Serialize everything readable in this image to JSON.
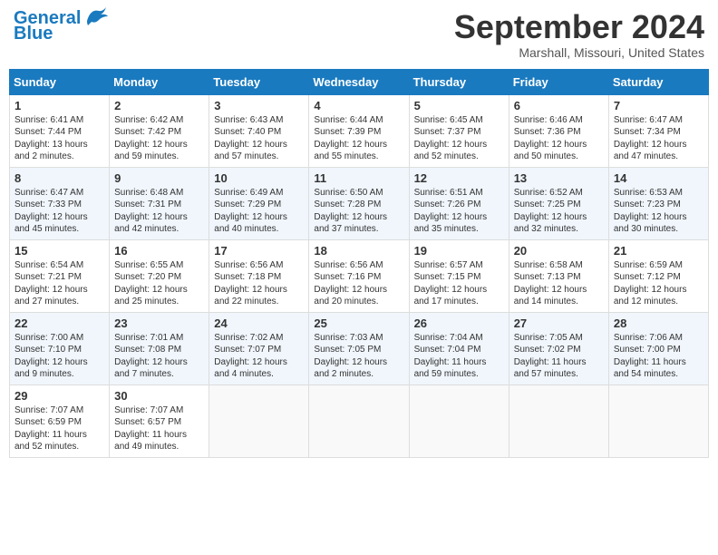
{
  "header": {
    "logo_line1": "General",
    "logo_line2": "Blue",
    "month_year": "September 2024",
    "location": "Marshall, Missouri, United States"
  },
  "days_of_week": [
    "Sunday",
    "Monday",
    "Tuesday",
    "Wednesday",
    "Thursday",
    "Friday",
    "Saturday"
  ],
  "weeks": [
    [
      {
        "day": "1",
        "info": "Sunrise: 6:41 AM\nSunset: 7:44 PM\nDaylight: 13 hours\nand 2 minutes."
      },
      {
        "day": "2",
        "info": "Sunrise: 6:42 AM\nSunset: 7:42 PM\nDaylight: 12 hours\nand 59 minutes."
      },
      {
        "day": "3",
        "info": "Sunrise: 6:43 AM\nSunset: 7:40 PM\nDaylight: 12 hours\nand 57 minutes."
      },
      {
        "day": "4",
        "info": "Sunrise: 6:44 AM\nSunset: 7:39 PM\nDaylight: 12 hours\nand 55 minutes."
      },
      {
        "day": "5",
        "info": "Sunrise: 6:45 AM\nSunset: 7:37 PM\nDaylight: 12 hours\nand 52 minutes."
      },
      {
        "day": "6",
        "info": "Sunrise: 6:46 AM\nSunset: 7:36 PM\nDaylight: 12 hours\nand 50 minutes."
      },
      {
        "day": "7",
        "info": "Sunrise: 6:47 AM\nSunset: 7:34 PM\nDaylight: 12 hours\nand 47 minutes."
      }
    ],
    [
      {
        "day": "8",
        "info": "Sunrise: 6:47 AM\nSunset: 7:33 PM\nDaylight: 12 hours\nand 45 minutes."
      },
      {
        "day": "9",
        "info": "Sunrise: 6:48 AM\nSunset: 7:31 PM\nDaylight: 12 hours\nand 42 minutes."
      },
      {
        "day": "10",
        "info": "Sunrise: 6:49 AM\nSunset: 7:29 PM\nDaylight: 12 hours\nand 40 minutes."
      },
      {
        "day": "11",
        "info": "Sunrise: 6:50 AM\nSunset: 7:28 PM\nDaylight: 12 hours\nand 37 minutes."
      },
      {
        "day": "12",
        "info": "Sunrise: 6:51 AM\nSunset: 7:26 PM\nDaylight: 12 hours\nand 35 minutes."
      },
      {
        "day": "13",
        "info": "Sunrise: 6:52 AM\nSunset: 7:25 PM\nDaylight: 12 hours\nand 32 minutes."
      },
      {
        "day": "14",
        "info": "Sunrise: 6:53 AM\nSunset: 7:23 PM\nDaylight: 12 hours\nand 30 minutes."
      }
    ],
    [
      {
        "day": "15",
        "info": "Sunrise: 6:54 AM\nSunset: 7:21 PM\nDaylight: 12 hours\nand 27 minutes."
      },
      {
        "day": "16",
        "info": "Sunrise: 6:55 AM\nSunset: 7:20 PM\nDaylight: 12 hours\nand 25 minutes."
      },
      {
        "day": "17",
        "info": "Sunrise: 6:56 AM\nSunset: 7:18 PM\nDaylight: 12 hours\nand 22 minutes."
      },
      {
        "day": "18",
        "info": "Sunrise: 6:56 AM\nSunset: 7:16 PM\nDaylight: 12 hours\nand 20 minutes."
      },
      {
        "day": "19",
        "info": "Sunrise: 6:57 AM\nSunset: 7:15 PM\nDaylight: 12 hours\nand 17 minutes."
      },
      {
        "day": "20",
        "info": "Sunrise: 6:58 AM\nSunset: 7:13 PM\nDaylight: 12 hours\nand 14 minutes."
      },
      {
        "day": "21",
        "info": "Sunrise: 6:59 AM\nSunset: 7:12 PM\nDaylight: 12 hours\nand 12 minutes."
      }
    ],
    [
      {
        "day": "22",
        "info": "Sunrise: 7:00 AM\nSunset: 7:10 PM\nDaylight: 12 hours\nand 9 minutes."
      },
      {
        "day": "23",
        "info": "Sunrise: 7:01 AM\nSunset: 7:08 PM\nDaylight: 12 hours\nand 7 minutes."
      },
      {
        "day": "24",
        "info": "Sunrise: 7:02 AM\nSunset: 7:07 PM\nDaylight: 12 hours\nand 4 minutes."
      },
      {
        "day": "25",
        "info": "Sunrise: 7:03 AM\nSunset: 7:05 PM\nDaylight: 12 hours\nand 2 minutes."
      },
      {
        "day": "26",
        "info": "Sunrise: 7:04 AM\nSunset: 7:04 PM\nDaylight: 11 hours\nand 59 minutes."
      },
      {
        "day": "27",
        "info": "Sunrise: 7:05 AM\nSunset: 7:02 PM\nDaylight: 11 hours\nand 57 minutes."
      },
      {
        "day": "28",
        "info": "Sunrise: 7:06 AM\nSunset: 7:00 PM\nDaylight: 11 hours\nand 54 minutes."
      }
    ],
    [
      {
        "day": "29",
        "info": "Sunrise: 7:07 AM\nSunset: 6:59 PM\nDaylight: 11 hours\nand 52 minutes."
      },
      {
        "day": "30",
        "info": "Sunrise: 7:07 AM\nSunset: 6:57 PM\nDaylight: 11 hours\nand 49 minutes."
      },
      {
        "day": "",
        "info": ""
      },
      {
        "day": "",
        "info": ""
      },
      {
        "day": "",
        "info": ""
      },
      {
        "day": "",
        "info": ""
      },
      {
        "day": "",
        "info": ""
      }
    ]
  ]
}
